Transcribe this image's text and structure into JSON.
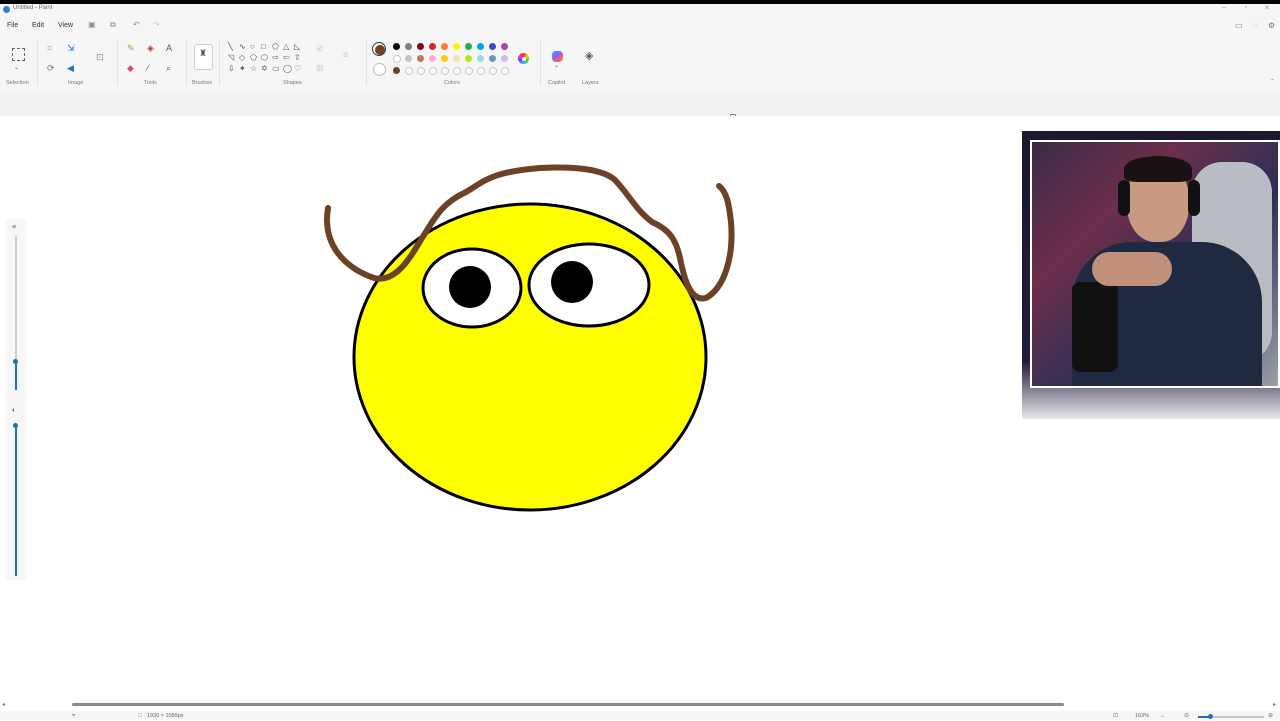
{
  "window": {
    "title": "Untitled - Paint"
  },
  "menu": {
    "file": "File",
    "edit": "Edit",
    "view": "View"
  },
  "ribbon": {
    "groups": {
      "selection": "Selection",
      "image": "Image",
      "tools": "Tools",
      "brushes": "Brushes",
      "shapes": "Shapes",
      "colors": "Colors",
      "copilot": "Copilot",
      "layers": "Layers"
    },
    "tools": {
      "text_glyph": "A"
    }
  },
  "colors": {
    "current": "#6b4226",
    "palette_row1": [
      "#000000",
      "#7f7f7f",
      "#880015",
      "#ed1c24",
      "#ff7f27",
      "#fff200",
      "#22b14c",
      "#00a2e8",
      "#3f48cc",
      "#a349a4"
    ],
    "palette_row2": [
      "#ffffff",
      "#c3c3c3",
      "#b97a57",
      "#ffaec9",
      "#ffc90e",
      "#efe4b0",
      "#b5e61d",
      "#99d9ea",
      "#7092be",
      "#c8bfe7"
    ],
    "custom": [
      "#6b4226"
    ]
  },
  "drawing": {
    "face_fill": "#ffff00",
    "outline": "#000000",
    "hair": "#6b4226"
  },
  "status": {
    "canvas_size": "1930 × 1089px",
    "zoom": "163%"
  }
}
